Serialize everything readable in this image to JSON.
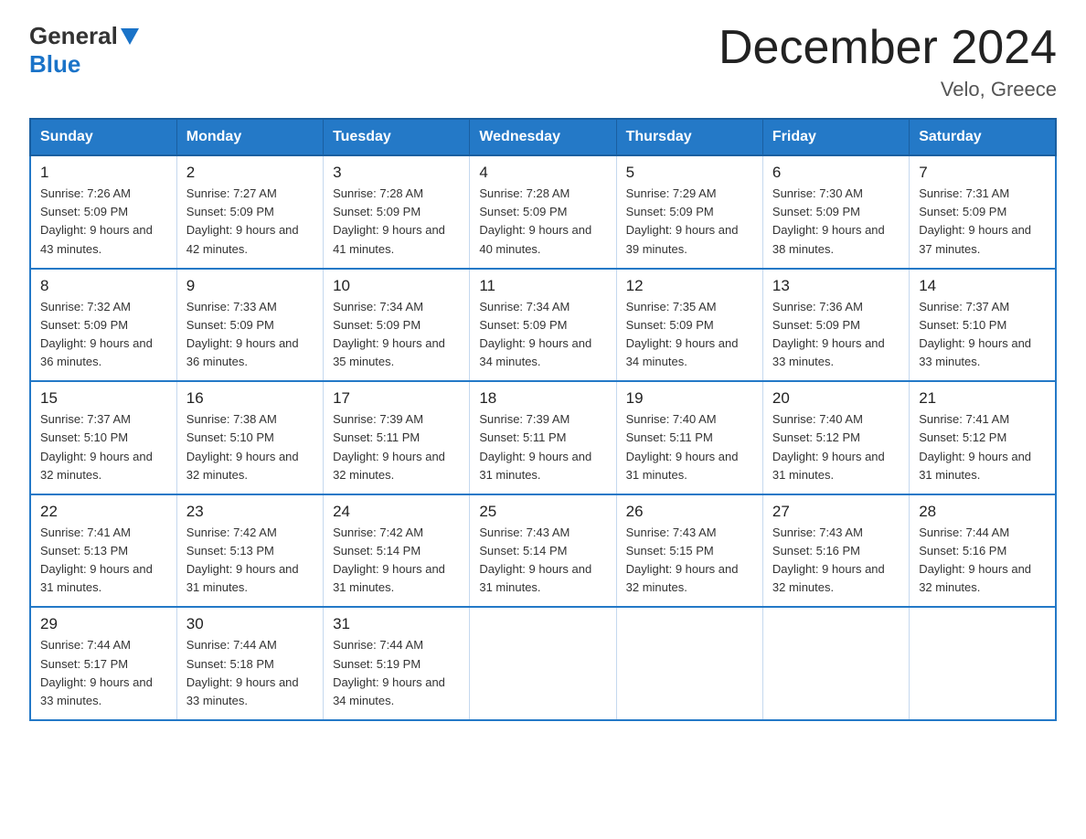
{
  "header": {
    "logo_general": "General",
    "logo_blue": "Blue",
    "month_title": "December 2024",
    "location": "Velo, Greece"
  },
  "days_of_week": [
    "Sunday",
    "Monday",
    "Tuesday",
    "Wednesday",
    "Thursday",
    "Friday",
    "Saturday"
  ],
  "weeks": [
    [
      {
        "num": "1",
        "sunrise": "7:26 AM",
        "sunset": "5:09 PM",
        "daylight": "9 hours and 43 minutes."
      },
      {
        "num": "2",
        "sunrise": "7:27 AM",
        "sunset": "5:09 PM",
        "daylight": "9 hours and 42 minutes."
      },
      {
        "num": "3",
        "sunrise": "7:28 AM",
        "sunset": "5:09 PM",
        "daylight": "9 hours and 41 minutes."
      },
      {
        "num": "4",
        "sunrise": "7:28 AM",
        "sunset": "5:09 PM",
        "daylight": "9 hours and 40 minutes."
      },
      {
        "num": "5",
        "sunrise": "7:29 AM",
        "sunset": "5:09 PM",
        "daylight": "9 hours and 39 minutes."
      },
      {
        "num": "6",
        "sunrise": "7:30 AM",
        "sunset": "5:09 PM",
        "daylight": "9 hours and 38 minutes."
      },
      {
        "num": "7",
        "sunrise": "7:31 AM",
        "sunset": "5:09 PM",
        "daylight": "9 hours and 37 minutes."
      }
    ],
    [
      {
        "num": "8",
        "sunrise": "7:32 AM",
        "sunset": "5:09 PM",
        "daylight": "9 hours and 36 minutes."
      },
      {
        "num": "9",
        "sunrise": "7:33 AM",
        "sunset": "5:09 PM",
        "daylight": "9 hours and 36 minutes."
      },
      {
        "num": "10",
        "sunrise": "7:34 AM",
        "sunset": "5:09 PM",
        "daylight": "9 hours and 35 minutes."
      },
      {
        "num": "11",
        "sunrise": "7:34 AM",
        "sunset": "5:09 PM",
        "daylight": "9 hours and 34 minutes."
      },
      {
        "num": "12",
        "sunrise": "7:35 AM",
        "sunset": "5:09 PM",
        "daylight": "9 hours and 34 minutes."
      },
      {
        "num": "13",
        "sunrise": "7:36 AM",
        "sunset": "5:09 PM",
        "daylight": "9 hours and 33 minutes."
      },
      {
        "num": "14",
        "sunrise": "7:37 AM",
        "sunset": "5:10 PM",
        "daylight": "9 hours and 33 minutes."
      }
    ],
    [
      {
        "num": "15",
        "sunrise": "7:37 AM",
        "sunset": "5:10 PM",
        "daylight": "9 hours and 32 minutes."
      },
      {
        "num": "16",
        "sunrise": "7:38 AM",
        "sunset": "5:10 PM",
        "daylight": "9 hours and 32 minutes."
      },
      {
        "num": "17",
        "sunrise": "7:39 AM",
        "sunset": "5:11 PM",
        "daylight": "9 hours and 32 minutes."
      },
      {
        "num": "18",
        "sunrise": "7:39 AM",
        "sunset": "5:11 PM",
        "daylight": "9 hours and 31 minutes."
      },
      {
        "num": "19",
        "sunrise": "7:40 AM",
        "sunset": "5:11 PM",
        "daylight": "9 hours and 31 minutes."
      },
      {
        "num": "20",
        "sunrise": "7:40 AM",
        "sunset": "5:12 PM",
        "daylight": "9 hours and 31 minutes."
      },
      {
        "num": "21",
        "sunrise": "7:41 AM",
        "sunset": "5:12 PM",
        "daylight": "9 hours and 31 minutes."
      }
    ],
    [
      {
        "num": "22",
        "sunrise": "7:41 AM",
        "sunset": "5:13 PM",
        "daylight": "9 hours and 31 minutes."
      },
      {
        "num": "23",
        "sunrise": "7:42 AM",
        "sunset": "5:13 PM",
        "daylight": "9 hours and 31 minutes."
      },
      {
        "num": "24",
        "sunrise": "7:42 AM",
        "sunset": "5:14 PM",
        "daylight": "9 hours and 31 minutes."
      },
      {
        "num": "25",
        "sunrise": "7:43 AM",
        "sunset": "5:14 PM",
        "daylight": "9 hours and 31 minutes."
      },
      {
        "num": "26",
        "sunrise": "7:43 AM",
        "sunset": "5:15 PM",
        "daylight": "9 hours and 32 minutes."
      },
      {
        "num": "27",
        "sunrise": "7:43 AM",
        "sunset": "5:16 PM",
        "daylight": "9 hours and 32 minutes."
      },
      {
        "num": "28",
        "sunrise": "7:44 AM",
        "sunset": "5:16 PM",
        "daylight": "9 hours and 32 minutes."
      }
    ],
    [
      {
        "num": "29",
        "sunrise": "7:44 AM",
        "sunset": "5:17 PM",
        "daylight": "9 hours and 33 minutes."
      },
      {
        "num": "30",
        "sunrise": "7:44 AM",
        "sunset": "5:18 PM",
        "daylight": "9 hours and 33 minutes."
      },
      {
        "num": "31",
        "sunrise": "7:44 AM",
        "sunset": "5:19 PM",
        "daylight": "9 hours and 34 minutes."
      },
      null,
      null,
      null,
      null
    ]
  ]
}
